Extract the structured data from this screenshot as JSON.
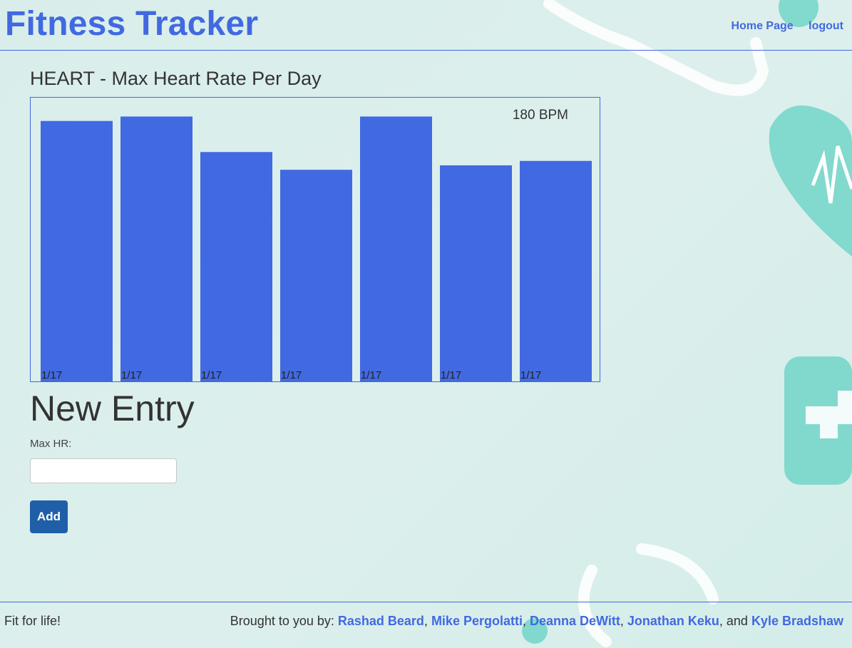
{
  "header": {
    "brand": "Fitness Tracker",
    "nav": [
      "Home Page",
      "logout"
    ]
  },
  "chart_section": {
    "title": "HEART - Max Heart Rate Per Day"
  },
  "chart_data": {
    "type": "bar",
    "title": "HEART - Max Heart Rate Per Day",
    "categories": [
      "1/17",
      "1/17",
      "1/17",
      "1/17",
      "1/17",
      "1/17",
      "1/17"
    ],
    "values": [
      176,
      179,
      155,
      143,
      179,
      146,
      149
    ],
    "unit": "BPM",
    "annotation": "180 BPM",
    "ylim": [
      0,
      185
    ],
    "bar_color": "#4169e1",
    "grid": false
  },
  "form": {
    "heading": "New Entry",
    "field_label": "Max HR:",
    "field_value": "",
    "button_label": "Add"
  },
  "footer": {
    "tagline": "Fit for life!",
    "credits_prefix": "Brought to you by: ",
    "authors": [
      "Rashad Beard",
      "Mike Pergolatti",
      "Deanna DeWitt",
      "Jonathan Keku",
      "Kyle Bradshaw"
    ],
    "separator": ", ",
    "last_joiner": ", and "
  },
  "colors": {
    "accent": "#4169e1",
    "button": "#1f5fa8",
    "decor": "#78d6cb"
  }
}
